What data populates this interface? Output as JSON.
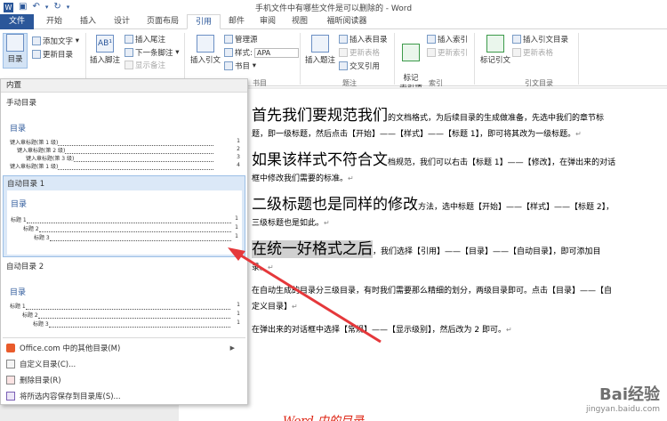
{
  "window": {
    "title": "手机文件中有哪些文件是可以删除的 - Word",
    "qat": [
      "save-icon",
      "undo-icon",
      "redo-icon"
    ]
  },
  "tabs": {
    "file": "文件",
    "items": [
      "开始",
      "插入",
      "设计",
      "页面布局",
      "引用",
      "邮件",
      "审阅",
      "视图",
      "福昕阅读器"
    ],
    "active": "引用"
  },
  "ribbon": {
    "toc": {
      "label": "目录",
      "add_text": "添加文字",
      "update_toc": "更新目录"
    },
    "footnotes": {
      "insert_footnote": "插入脚注",
      "insert_endnote": "插入尾注",
      "next_footnote": "下一条脚注",
      "show_notes": "显示备注"
    },
    "citations": {
      "insert_citation": "插入引文",
      "manage_sources": "管理源",
      "style_label": "样式:",
      "style_value": "APA",
      "bibliography": "书目",
      "group_label": "书目"
    },
    "captions": {
      "insert_caption": "插入题注",
      "insert_table_of_figures": "插入表目录",
      "update_table": "更新表格",
      "cross_reference": "交叉引用",
      "group_label": "题注"
    },
    "index": {
      "mark_entry": "标记\n索引项",
      "insert_index": "插入索引",
      "update_index": "更新索引",
      "group_label": "索引"
    },
    "authorities": {
      "mark_citation": "标记引文",
      "insert_table_of_authorities": "插入引文目录",
      "update_table": "更新表格",
      "group_label": "引文目录"
    }
  },
  "dropdown": {
    "header": "内置",
    "manual_title": "手动目录",
    "manual_toc": {
      "title": "目录",
      "lines": [
        "键入章标题(第 1 级)",
        "键入章标题(第 2 级)",
        "键入章标题(第 3 级)",
        "键入章标题(第 1 级)"
      ],
      "nums": [
        "1",
        "2",
        "3",
        "4"
      ]
    },
    "auto1_title": "自动目录 1",
    "auto1_toc": {
      "title": "目录",
      "lines": [
        "标题 1",
        "标题 2",
        "标题 3"
      ],
      "nums": [
        "1",
        "1",
        "1"
      ]
    },
    "auto2_title": "自动目录 2",
    "auto2_toc": {
      "title": "目录",
      "lines": [
        "标题 1",
        "标题 2",
        "标题 3"
      ],
      "nums": [
        "1",
        "1",
        "1"
      ]
    },
    "menu": [
      {
        "label": "Office.com 中的其他目录(M)",
        "icon": "office-icon"
      },
      {
        "label": "自定义目录(C)...",
        "icon": "custom-toc-icon"
      },
      {
        "label": "删除目录(R)",
        "icon": "remove-toc-icon"
      },
      {
        "label": "将所选内容保存到目录库(S)...",
        "icon": "save-selection-icon"
      }
    ]
  },
  "document": {
    "p1_head": "首先我们要规范我们",
    "p1_body": "的文档格式，为后续目录的生成做准备，先选中我们的章节标题，即一级标题，然后点击【开始】——【样式】——【标题 1】，即可将其改为一级标题。",
    "p2_head": "如果该样式不符合文",
    "p2_body": "档规范，我们可以右击【标题 1】——【修改】，在弹出来的对话框中修改我们需要的标准。",
    "p3_head": "二级标题也是同样的修改",
    "p3_body": "方法，选中标题【开始】——【样式】——【标题 2】，三级标题也是如此。",
    "p4_head": "在统一好格式之后",
    "p4_body": "，我们选择【引用】——【目录】——【自动目录】，即可添加目录。",
    "p5": "在自动生成的目录分三级目录，有时我们需要那么精细的划分，两级目录即可。点击【目录】——【自定义目录】",
    "p6": "在弹出来的对话框中选择【常规】——【显示级别】，然后改为 2 即可。",
    "pmark": "↵",
    "bottom_text": "Word 中的目录"
  },
  "watermark": {
    "brand": "Bai经验",
    "url": "jingyan.baidu.com"
  },
  "colors": {
    "accent": "#2b579a",
    "arrow": "#e5383b",
    "selection": "#dbe8f7"
  }
}
